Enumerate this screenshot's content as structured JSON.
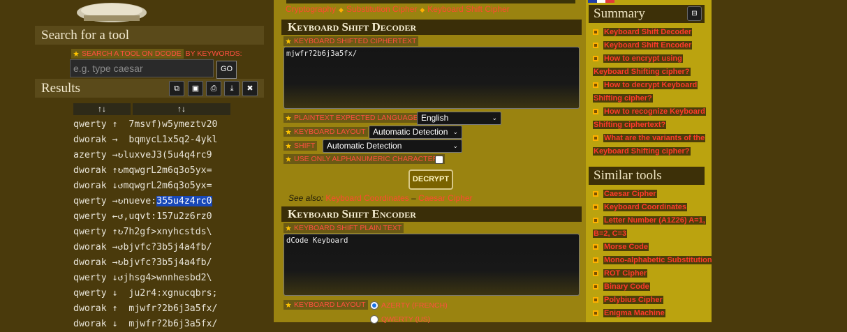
{
  "left": {
    "search_title": "Search for a tool",
    "search_tag": "SEARCH A TOOL ON DCODE",
    "search_tag_suffix": " BY KEYWORDS:",
    "search_placeholder": "e.g. type caesar",
    "go_label": "GO",
    "results_title": "Results",
    "result_buttons": [
      "copy-icon",
      "save-icon",
      "print-icon",
      "download-icon",
      "close-icon"
    ],
    "col_headers": [
      "↑↓",
      "↑↓"
    ],
    "results": [
      {
        "layout": "qwerty",
        "shift": "↑ ",
        "text": " 7msvf)w5ymeztv20"
      },
      {
        "layout": "dworak",
        "shift": "→ ",
        "text": " bqmycL1x5q2-4ykl"
      },
      {
        "layout": "azerty",
        "shift": "→↻",
        "text": "luxveJ3(5u4q4rc9"
      },
      {
        "layout": "dworak",
        "shift": "↑↻",
        "text": "mqwgrL2m6q3o5yx="
      },
      {
        "layout": "dworak",
        "shift": "↓↺",
        "text": "mqwgrL2m6q3o5yx="
      },
      {
        "layout": "qwerty",
        "shift": "→↻",
        "text": "nueve:",
        "hl": "355u4z4rc0"
      },
      {
        "layout": "qwerty",
        "shift": "←↺",
        "text": ",uqvt:157u2z6rz0"
      },
      {
        "layout": "qwerty",
        "shift": "↑↻",
        "text": "7h2gf>xnyhcstds\\"
      },
      {
        "layout": "dworak",
        "shift": "→↺",
        "text": "bjvfc?3b5j4a4fb/"
      },
      {
        "layout": "dworak",
        "shift": "→↻",
        "text": "bjvfc?3b5j4a4fb/"
      },
      {
        "layout": "qwerty",
        "shift": "↓↺",
        "text": "jhsg4>wnnhesbd2\\"
      },
      {
        "layout": "qwerty",
        "shift": "↓ ",
        "text": " ju2r4:xgnucqbrs;"
      },
      {
        "layout": "dworak",
        "shift": "↑ ",
        "text": " mjwfr?2b6j3a5fx/"
      },
      {
        "layout": "dworak",
        "shift": "↓ ",
        "text": " mjwfr?2b6j3a5fx/"
      }
    ]
  },
  "breadcrumb": [
    "Cryptography",
    "Substitution Cipher",
    "Keyboard Shift Cipher"
  ],
  "decoder": {
    "title": "Keyboard Shift Decoder",
    "cipher_label": "KEYBOARD SHIFTED CIPHERTEXT",
    "cipher_value": "mjwfr?2b6j3a5fx/",
    "lang_label": "PLAINTEXT EXPECTED LANGUAGE",
    "lang_value": "English",
    "layout_label": "KEYBOARD LAYOUT",
    "layout_value": "Automatic Detection",
    "shift_label": "SHIFT",
    "shift_value": "Automatic Detection",
    "alnum_label": "USE ONLY ALPHANUMERIC CHARACTERS",
    "decrypt_label": "DECRYPT",
    "see_also": "See also:",
    "see_also_links": [
      "Keyboard Coordinates",
      "Caesar Cipher"
    ],
    "see_also_sep": " – "
  },
  "encoder": {
    "title": "Keyboard Shift Encoder",
    "plain_label": "KEYBOARD SHIFT PLAIN TEXT",
    "plain_value": "dCode Keyboard",
    "layout_label": "KEYBOARD LAYOUT",
    "options": [
      "AZERTY (FRENCH)",
      "QWERTY (US)"
    ]
  },
  "summary": {
    "title": "Summary",
    "toggle": "⊟",
    "links": [
      [
        "Keyboard Shift Decoder"
      ],
      [
        "Keyboard Shift Encoder"
      ],
      [
        "How to encrypt using",
        "Keyboard Shifting cipher?"
      ],
      [
        "How to decrypt Keyboard",
        "Shifting cipher?"
      ],
      [
        "How to recognize Keyboard",
        "Shifting ciphertext?"
      ],
      [
        "What are the variants of the",
        "Keyboard Shifting cipher?"
      ]
    ]
  },
  "similar": {
    "title": "Similar tools",
    "links": [
      [
        "Caesar Cipher"
      ],
      [
        "Keyboard Coordinates"
      ],
      [
        "Letter Number (A1Z26) A=1,",
        "B=2, C=3"
      ],
      [
        "Morse Code"
      ],
      [
        "Mono-alphabetic Substitution"
      ],
      [
        "ROT Cipher"
      ],
      [
        "Binary Code"
      ],
      [
        "Polybius Cipher"
      ],
      [
        "Enigma Machine"
      ]
    ]
  }
}
